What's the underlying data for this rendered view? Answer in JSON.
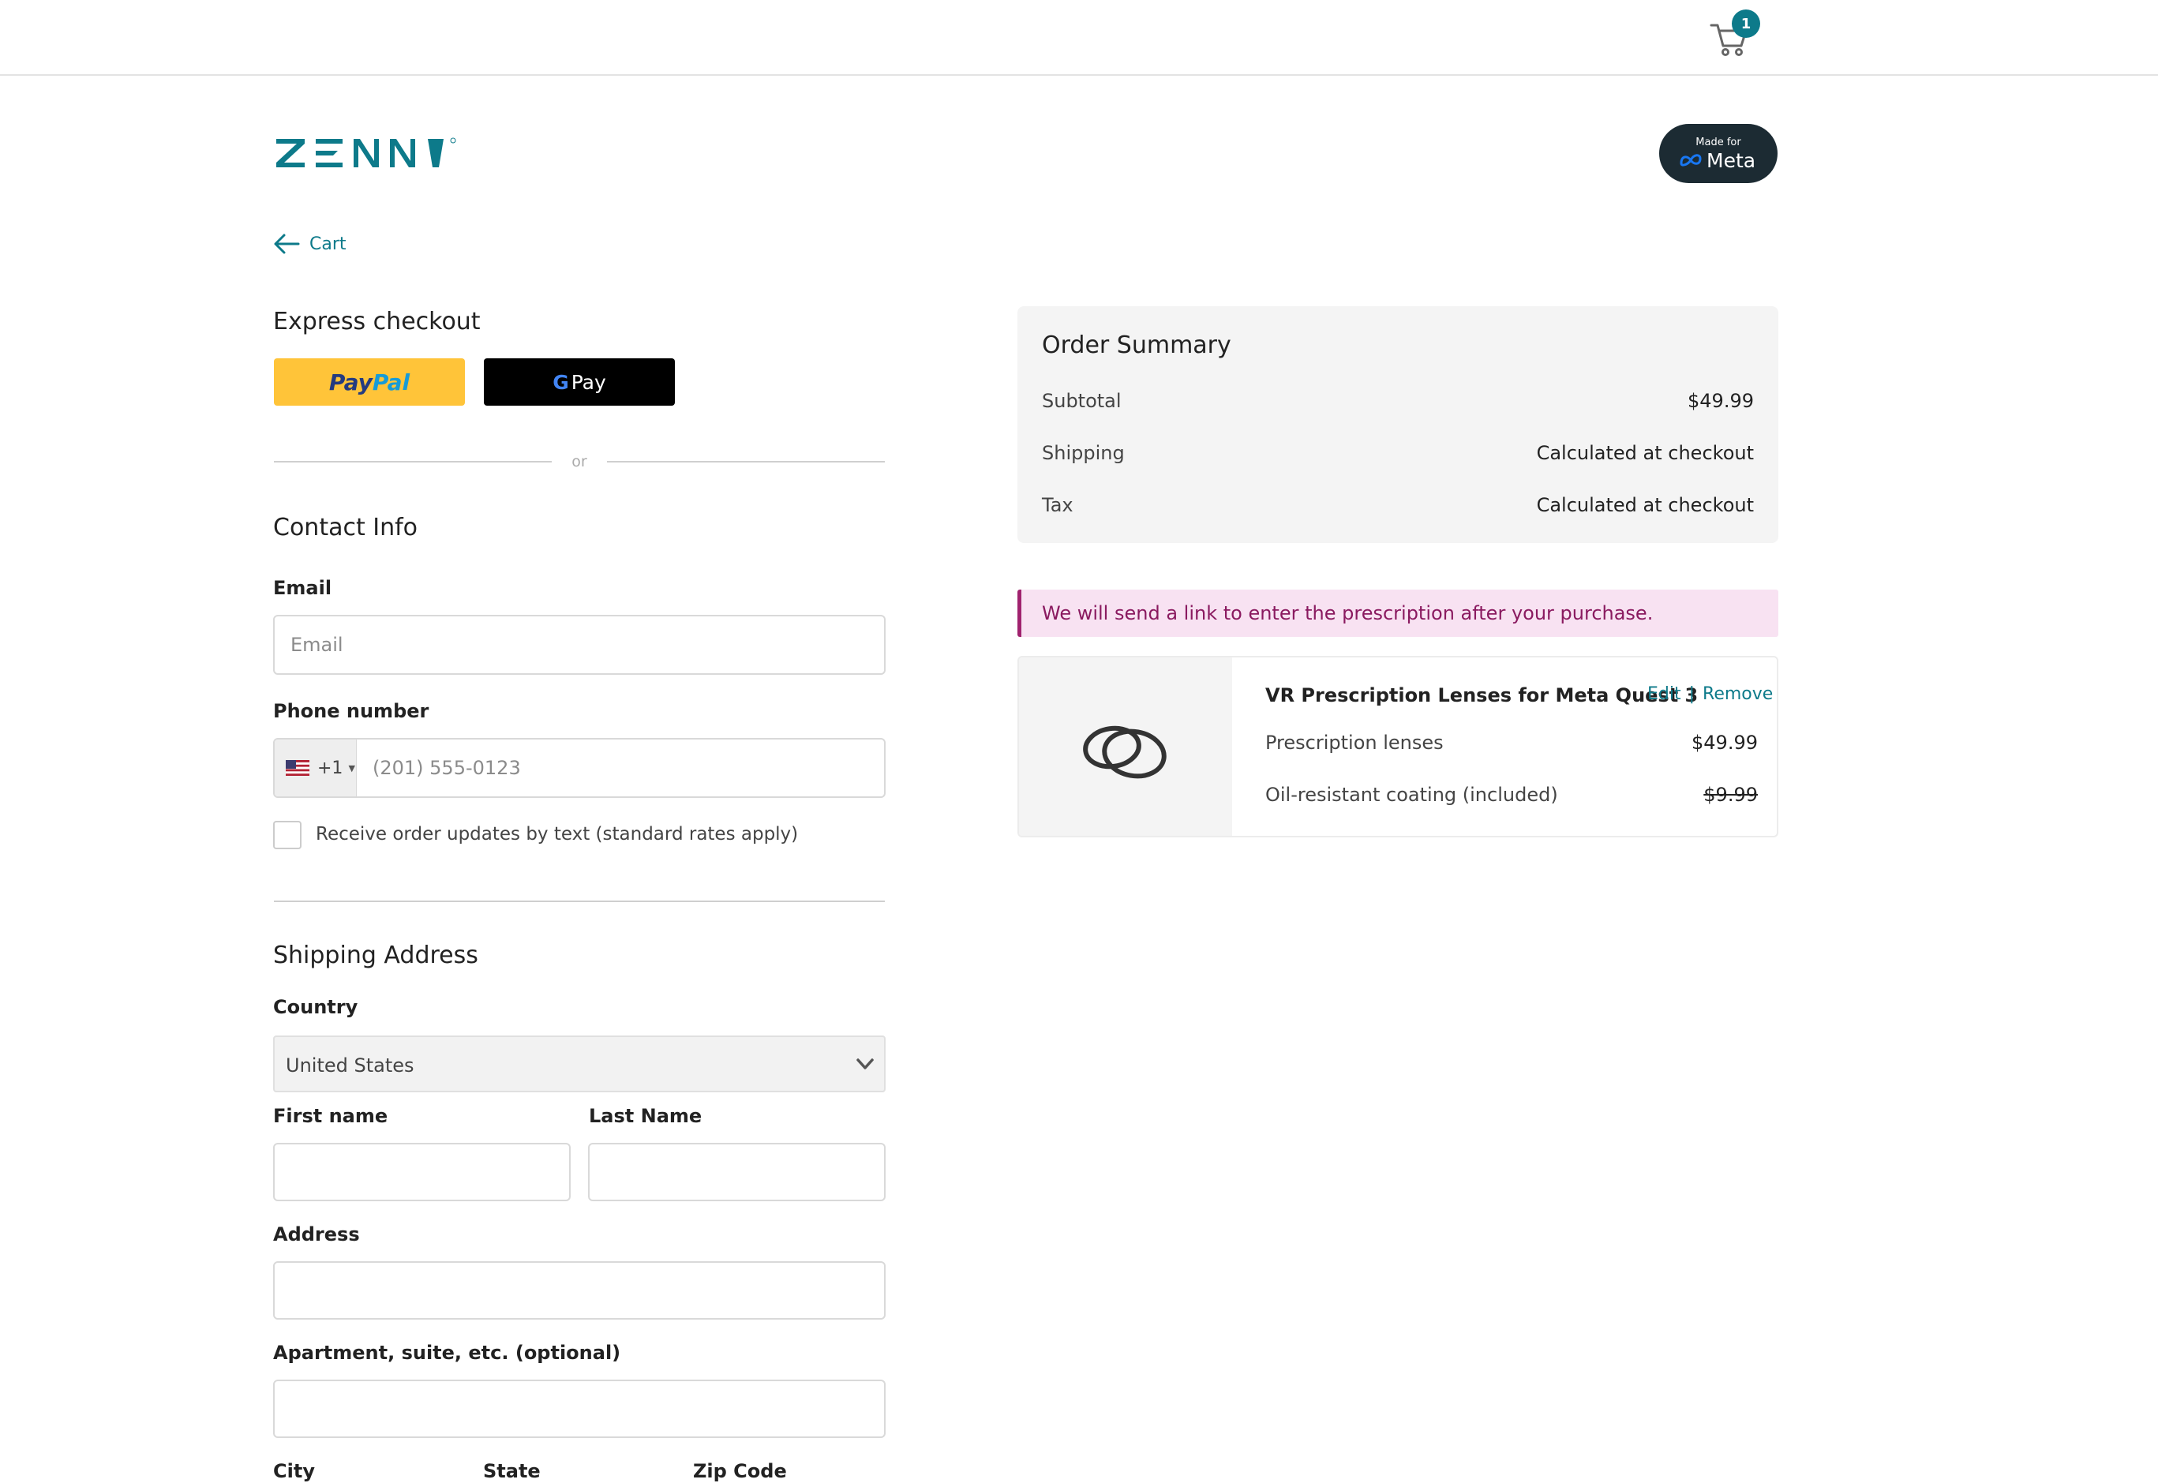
{
  "header": {
    "cart_count": "1"
  },
  "brand": {
    "logo_text": "ZENNI",
    "meta_badge_small": "Made for",
    "meta_badge_word": "Meta",
    "accent_color": "#0d7a8a"
  },
  "nav": {
    "back_label": "Cart"
  },
  "express": {
    "title": "Express checkout",
    "paypal_a": "Pay",
    "paypal_b": "Pal",
    "gpay_g": "G",
    "gpay_label": "Pay",
    "divider_text": "or"
  },
  "contact": {
    "title": "Contact Info",
    "email_label": "Email",
    "email_placeholder": "Email",
    "email_value": "",
    "phone_label": "Phone number",
    "phone_code": "+1",
    "phone_placeholder": "(201) 555-0123",
    "sms_opt_in_label": "Receive order updates by text (standard rates apply)",
    "sms_opt_in_checked": false
  },
  "shipping": {
    "title": "Shipping Address",
    "country_label": "Country",
    "country_value": "United States",
    "first_name_label": "First name",
    "last_name_label": "Last Name",
    "address_label": "Address",
    "apartment_label": "Apartment, suite, etc. (optional)",
    "city_label": "City",
    "state_label": "State",
    "zip_label": "Zip Code"
  },
  "summary": {
    "title": "Order Summary",
    "subtotal_label": "Subtotal",
    "subtotal_value": "$49.99",
    "shipping_label": "Shipping",
    "shipping_value": "Calculated at checkout",
    "tax_label": "Tax",
    "tax_value": "Calculated at checkout"
  },
  "notice": {
    "text": "We will send a link to enter the prescription after your purchase."
  },
  "item": {
    "title": "VR Prescription Lenses for Meta Quest 3",
    "edit_label": "Edit",
    "separator": "|",
    "remove_label": "Remove",
    "line1_label": "Prescription lenses",
    "line1_value": "$49.99",
    "line2_label": "Oil-resistant coating (included)",
    "line2_value": "$9.99"
  },
  "icons": [
    "cart-icon",
    "arrow-left-icon",
    "us-flag-icon",
    "chevron-down-icon",
    "lens-icon",
    "meta-infinity-icon"
  ]
}
